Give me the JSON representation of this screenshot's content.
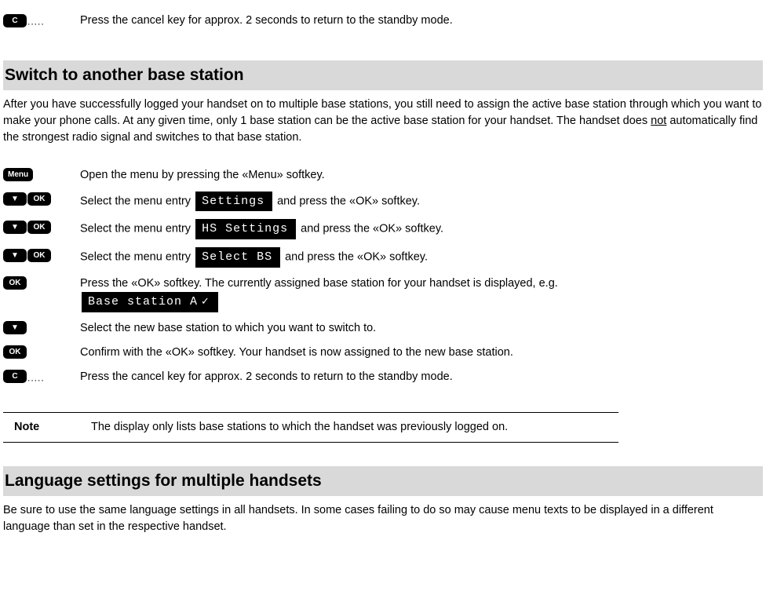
{
  "intro_step_text": "Press the cancel key for approx. 2 seconds to return to the standby mode.",
  "keys": {
    "c": "C",
    "menu": "Menu",
    "ok": "OK"
  },
  "heading_switch": "Switch to another base station",
  "switch_intro_pre": "After you have successfully logged your handset on to multiple base stations, you still need to assign the active base station through which you want to make your phone calls. At any given time, only 1 base station can be the active base station for your handset. The handset does ",
  "switch_intro_not": "not",
  "switch_intro_post": " automatically find the strongest radio signal and switches to that base station.",
  "steps": {
    "s1": "Open the menu by pressing the «Menu» softkey.",
    "s2_pre": "Select the menu entry ",
    "s2_screen": "Settings",
    "s2_post": " and press the «OK» softkey.",
    "s3_pre": "Select the menu entry ",
    "s3_screen": "HS Settings",
    "s3_post": " and press the «OK» softkey.",
    "s4_pre": "Select the menu entry ",
    "s4_screen": "Select BS",
    "s4_post": " and press the «OK» softkey.",
    "s5_pre": "Press the «OK» softkey. The currently assigned base station for your handset is displayed, e.g. ",
    "s5_screen": "Base station A",
    "s6": "Select the new base station to which you want to switch to.",
    "s7": "Confirm with the «OK» softkey. Your handset is now assigned to the new base station.",
    "s8": "Press the cancel key for approx. 2 seconds to return to the standby mode."
  },
  "note_label": "Note",
  "note_text": "The display only lists base stations to which the handset was previously logged on.",
  "heading_language": "Language settings for multiple handsets",
  "language_text": "Be sure to use the same language settings in all handsets. In some cases failing to do so may cause menu texts to be displayed in a different language than set in the respective handset."
}
